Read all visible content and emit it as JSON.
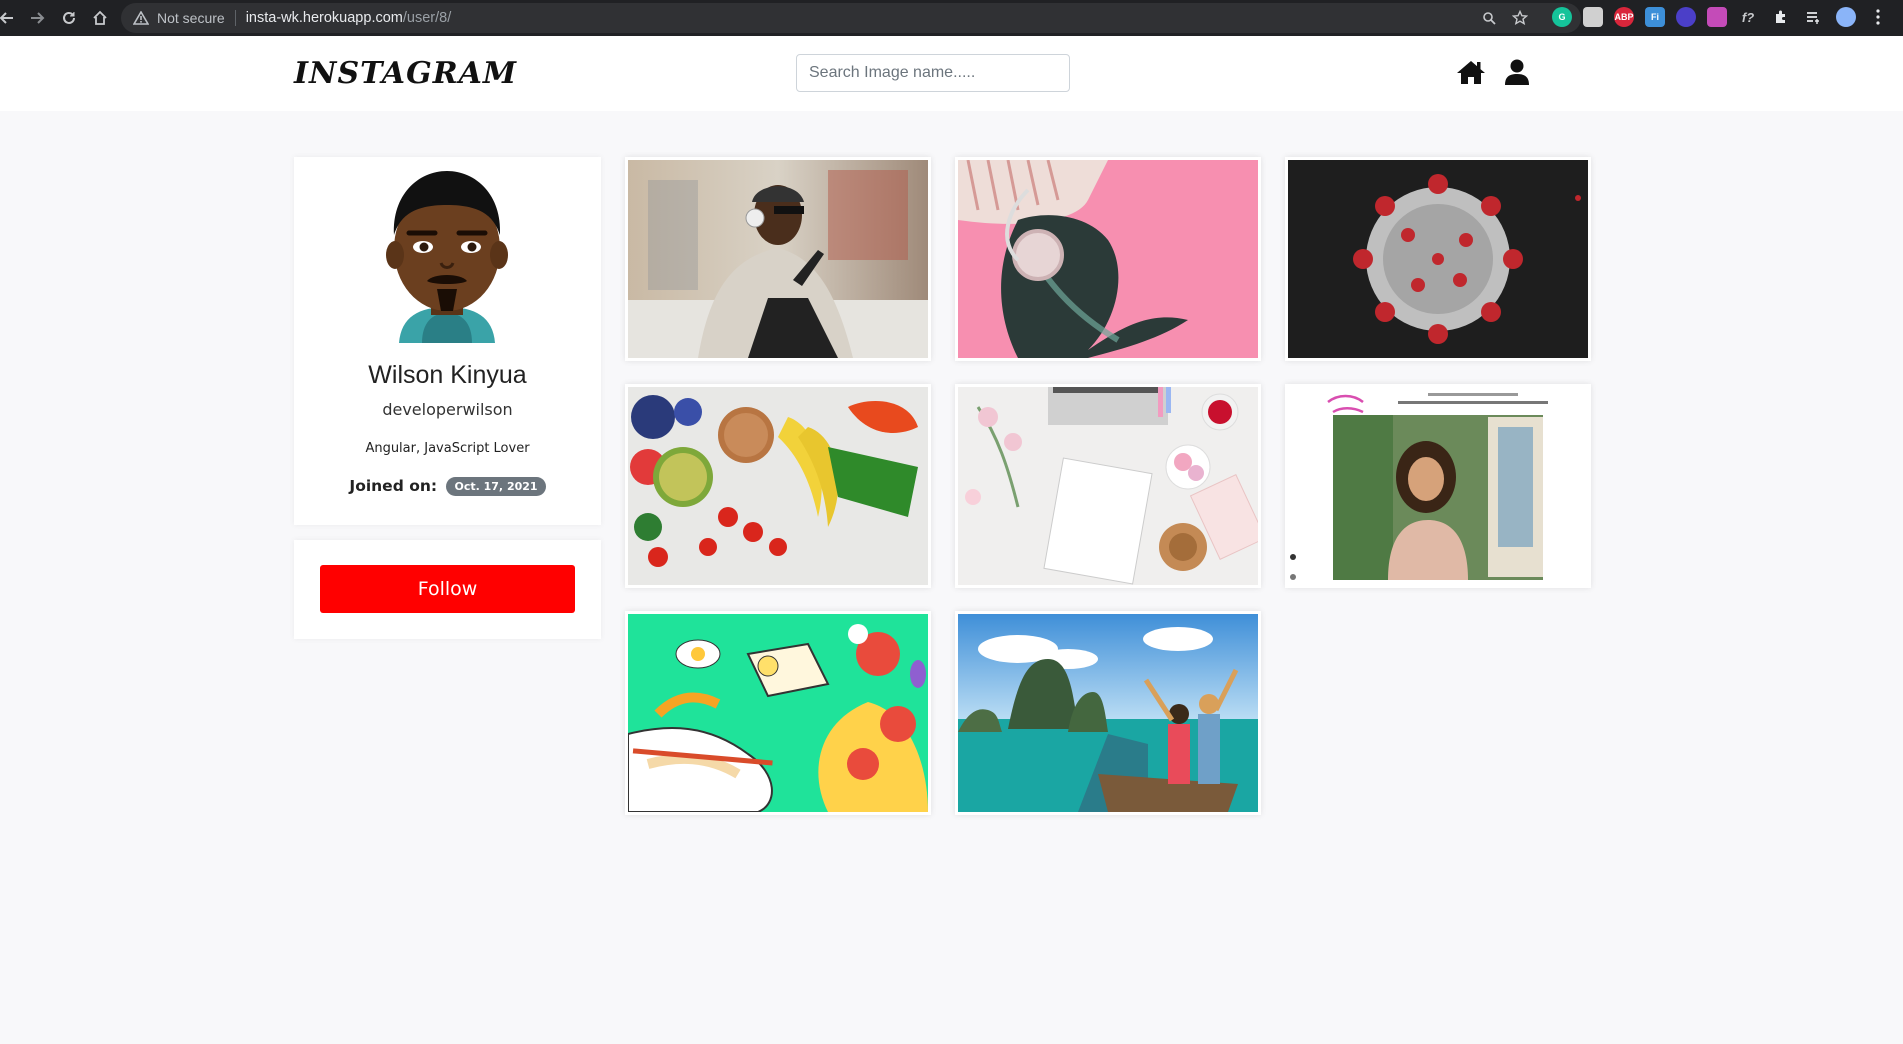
{
  "browser": {
    "security_label": "Not secure",
    "url_host": "insta-wk.herokuapp.com",
    "url_path": "/user/8/",
    "icons": [
      "back-icon",
      "forward-icon",
      "reload-icon",
      "home-icon",
      "warning-icon",
      "zoom-icon",
      "star-icon",
      "grammarly-icon",
      "extension-icon",
      "adblock-icon",
      "extension-icon",
      "extension-icon",
      "extension-icon",
      "formula-icon",
      "puzzle-icon",
      "reading-list-icon",
      "profile-avatar-icon",
      "menu-icon"
    ],
    "extension_badges": {
      "abp": "ABP",
      "fi": "Fi",
      "f": "f?"
    }
  },
  "navbar": {
    "brand": "INSTAGRAM",
    "search_placeholder": "Search Image name.....",
    "icons": [
      "home-icon",
      "user-icon"
    ]
  },
  "profile": {
    "name": "Wilson Kinyua",
    "username": "developerwilson",
    "bio": "Angular, JavaScript Lover",
    "joined_label": "Joined on:",
    "joined_date": "Oct. 17, 2021",
    "follow_label": "Follow"
  },
  "colors": {
    "follow_button": "#ff0000",
    "badge": "#6c757d",
    "page_bg": "#f8f8fa"
  },
  "gallery": [
    {
      "id": "man-headphones-phone"
    },
    {
      "id": "woman-headphones-pink"
    },
    {
      "id": "coronavirus"
    },
    {
      "id": "fruits-vegetables"
    },
    {
      "id": "desk-flatlay"
    },
    {
      "id": "website-screenshot-woman"
    },
    {
      "id": "food-illustration-chef"
    },
    {
      "id": "travel-boat-islands"
    }
  ]
}
